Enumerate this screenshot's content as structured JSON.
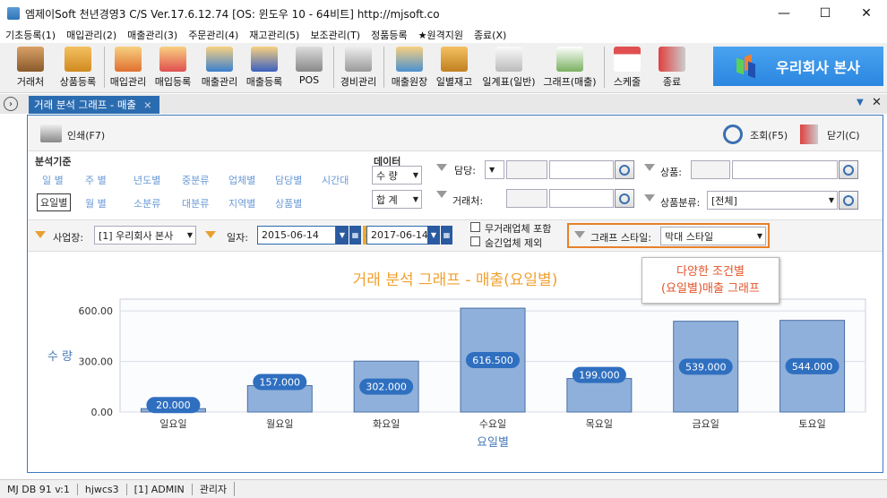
{
  "window": {
    "title": "엠제이Soft 천년경영3 C/S    Ver.17.6.12.74   [OS: 윈도우 10 - 64비트]   http://mjsoft.co",
    "minimize": "—",
    "maximize": "☐",
    "close": "✕"
  },
  "menu": [
    "기초등록(1)",
    "매입관리(2)",
    "매출관리(3)",
    "주문관리(4)",
    "재고관리(5)",
    "보조관리(T)",
    "정품등록",
    "★원격지원",
    "종료(X)"
  ],
  "toolbar": [
    "거래처",
    "상품등록",
    "매입관리",
    "매입등록",
    "매출관리",
    "매출등록",
    "POS",
    "경비관리",
    "매출원장",
    "일별재고",
    "일계표(일반)",
    "그래프(매출)",
    "스케줄",
    "종료"
  ],
  "company": "우리회사 본사",
  "tab": {
    "label": "거래 분석 그래프 - 매출",
    "close": "×"
  },
  "subtoolbar": {
    "print": "인쇄(F7)",
    "search": "조회(F5)",
    "close": "닫기(C)"
  },
  "filters": {
    "basis_title": "분석기준",
    "basis_row1": [
      "일 별",
      "주 별",
      "년도별",
      "중분류",
      "업체별",
      "담당별",
      "시간대"
    ],
    "basis_row2": [
      "요일별",
      "월 별",
      "소분류",
      "대분류",
      "지역별",
      "상품별"
    ],
    "data_title": "데이터",
    "data_select": "수 량",
    "sum_select": "합 계",
    "manager_label": "담당:",
    "customer_label": "거래처:",
    "product_label": "상품:",
    "category_label": "상품분류:",
    "category_value": "[전체]"
  },
  "row2": {
    "site_label": "사업장:",
    "site_value": "[1] 우리회사 본사",
    "date_label": "일자:",
    "date_from": "2015-06-14",
    "tilde": "~",
    "date_to": "2017-06-14",
    "chk1": "무거래업체 포함",
    "chk2": "숨긴업체 제외",
    "style_label": "그래프 스타일:",
    "style_value": "막대 스타일"
  },
  "callout": [
    "다양한 조건별",
    "(요일별)매출 그래프"
  ],
  "chart_data": {
    "type": "bar",
    "title": "거래 분석 그래프 - 매출(요일별)",
    "xlabel": "요일별",
    "ylabel": "수 량",
    "categories": [
      "일요일",
      "월요일",
      "화요일",
      "수요일",
      "목요일",
      "금요일",
      "토요일"
    ],
    "values": [
      20,
      157,
      302,
      616.5,
      199,
      539,
      544
    ],
    "value_labels": [
      "20.000",
      "157.000",
      "302.000",
      "616.500",
      "199.000",
      "539.000",
      "544.000"
    ],
    "yticks": [
      "0.00",
      "300.00",
      "600.00"
    ],
    "ytick_values": [
      0,
      300,
      600
    ],
    "ylim": [
      0,
      670
    ],
    "bar_color": "#8fb0da",
    "label_color": "#2f6fc0",
    "title_color": "#f0a030"
  },
  "status": [
    "MJ DB 91 v:1",
    "hjwcs3",
    "[1] ADMIN",
    "관리자"
  ]
}
